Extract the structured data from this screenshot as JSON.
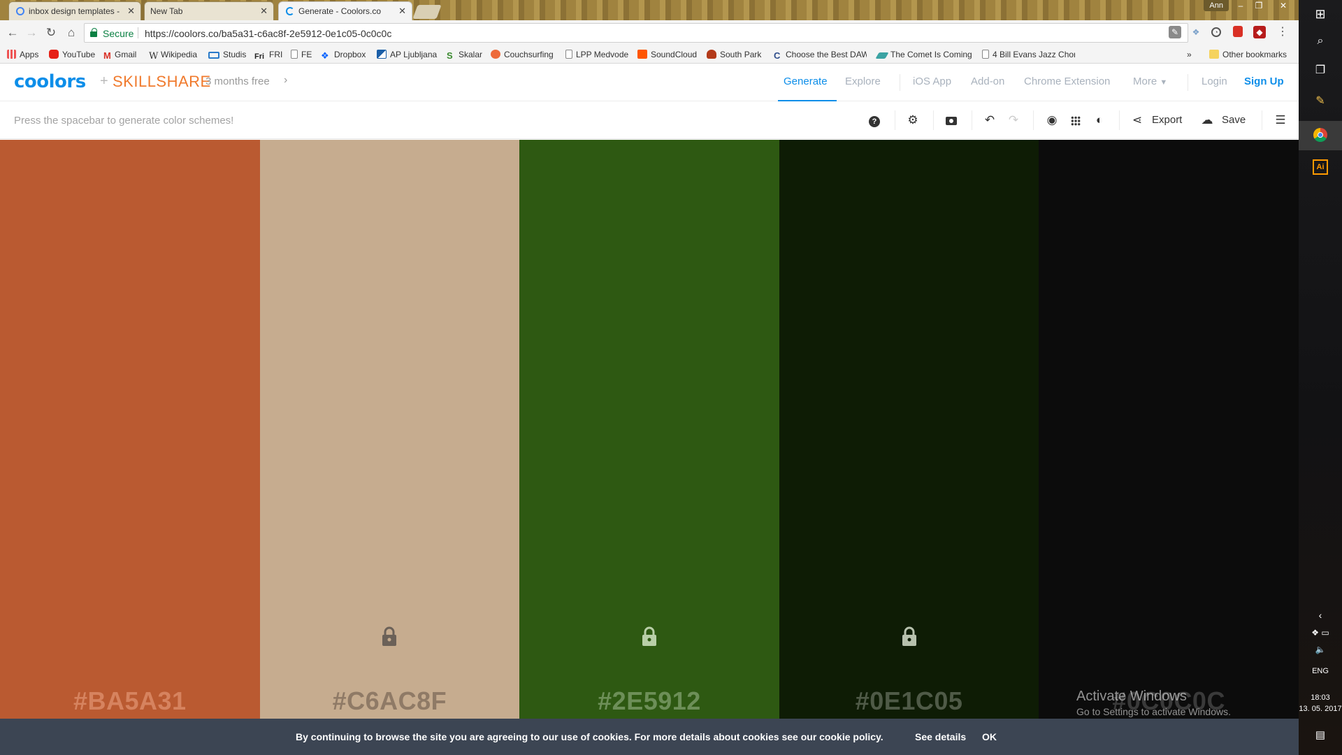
{
  "browser": {
    "tabs": [
      {
        "title": "inbox design templates -",
        "favicon_color": "#4285f4"
      },
      {
        "title": "New Tab",
        "favicon_color": ""
      },
      {
        "title": "Generate - Coolors.co",
        "favicon_color": "#0d8ee9"
      }
    ],
    "user": "Ann",
    "secure_label": "Secure",
    "url": "https://coolors.co/ba5a31-c6ac8f-2e5912-0e1c05-0c0c0c",
    "bookmarks": [
      {
        "label": "Apps",
        "icon": "apps-grid-icon",
        "color": "#e55"
      },
      {
        "label": "YouTube",
        "icon": "youtube-icon",
        "color": "#e62117"
      },
      {
        "label": "Gmail",
        "icon": "gmail-icon",
        "color": "#d93025"
      },
      {
        "label": "Wikipedia",
        "icon": "wikipedia-icon",
        "color": "#333"
      },
      {
        "label": "Studis",
        "icon": "studis-icon",
        "color": "#2a7ac9"
      },
      {
        "label": "FRI",
        "icon": "fri-icon",
        "color": "#222"
      },
      {
        "label": "FE",
        "icon": "page-icon",
        "color": "#888"
      },
      {
        "label": "Dropbox",
        "icon": "dropbox-icon",
        "color": "#0061ff"
      },
      {
        "label": "AP Ljubljana",
        "icon": "ap-icon",
        "color": "#1b5fa8"
      },
      {
        "label": "Skalar",
        "icon": "skalar-icon",
        "color": "#3a8a2f"
      },
      {
        "label": "Couchsurfing",
        "icon": "couchsurfing-icon",
        "color": "#ed6b3b"
      },
      {
        "label": "LPP Medvode",
        "icon": "page-icon",
        "color": "#888"
      },
      {
        "label": "SoundCloud",
        "icon": "soundcloud-icon",
        "color": "#ff5500"
      },
      {
        "label": "South Park",
        "icon": "southpark-icon",
        "color": "#b33a1a"
      },
      {
        "label": "Choose the Best DAW",
        "icon": "daw-icon",
        "color": "#2d4c8a"
      },
      {
        "label": "The Comet Is Coming",
        "icon": "comet-icon",
        "color": "#3ba3a3"
      },
      {
        "label": "4 Bill Evans Jazz Chor",
        "icon": "page-icon",
        "color": "#888"
      }
    ],
    "overflow_label": "»",
    "other_bookmarks": "Other bookmarks"
  },
  "site": {
    "logo": "coolors",
    "plus": "+",
    "partner": "SKILLSHARE",
    "promo": "3 months free",
    "nav": [
      "Generate",
      "Explore",
      "iOS App",
      "Add-on",
      "Chrome Extension",
      "More",
      "Login",
      "Sign Up"
    ]
  },
  "toolbar": {
    "hint": "Press the spacebar to generate color schemes!",
    "export_label": "Export",
    "save_label": "Save"
  },
  "palette": [
    {
      "hex": "#BA5A31",
      "color": "#ba5a31",
      "label_color": "#d6835f",
      "locked": false
    },
    {
      "hex": "#C6AC8F",
      "color": "#c6ac8f",
      "label_color": "#8f7a66",
      "locked": true,
      "lock_color": "#6b6158"
    },
    {
      "hex": "#2E5912",
      "color": "#2e5912",
      "label_color": "#6d8f58",
      "locked": true,
      "lock_color": "#b9cfa8"
    },
    {
      "hex": "#0E1C05",
      "color": "#0e1c05",
      "label_color": "#4f5a47",
      "locked": true,
      "lock_color": "#b7c1ae"
    },
    {
      "hex": "#0C0C0C",
      "color": "#0c0c0c",
      "label_color": "#3a3a3a",
      "locked": false
    }
  ],
  "cookie": {
    "text": "By continuing to browse the site you are agreeing to our use of cookies. For more details about cookies see our cookie policy.",
    "details": "See details",
    "ok": "OK"
  },
  "watermark": {
    "title": "Activate Windows",
    "subtitle": "Go to Settings to activate Windows."
  },
  "taskbar": {
    "lang": "ENG",
    "time": "18:03",
    "date": "13. 05. 2017",
    "adobe_label": "Ai"
  }
}
